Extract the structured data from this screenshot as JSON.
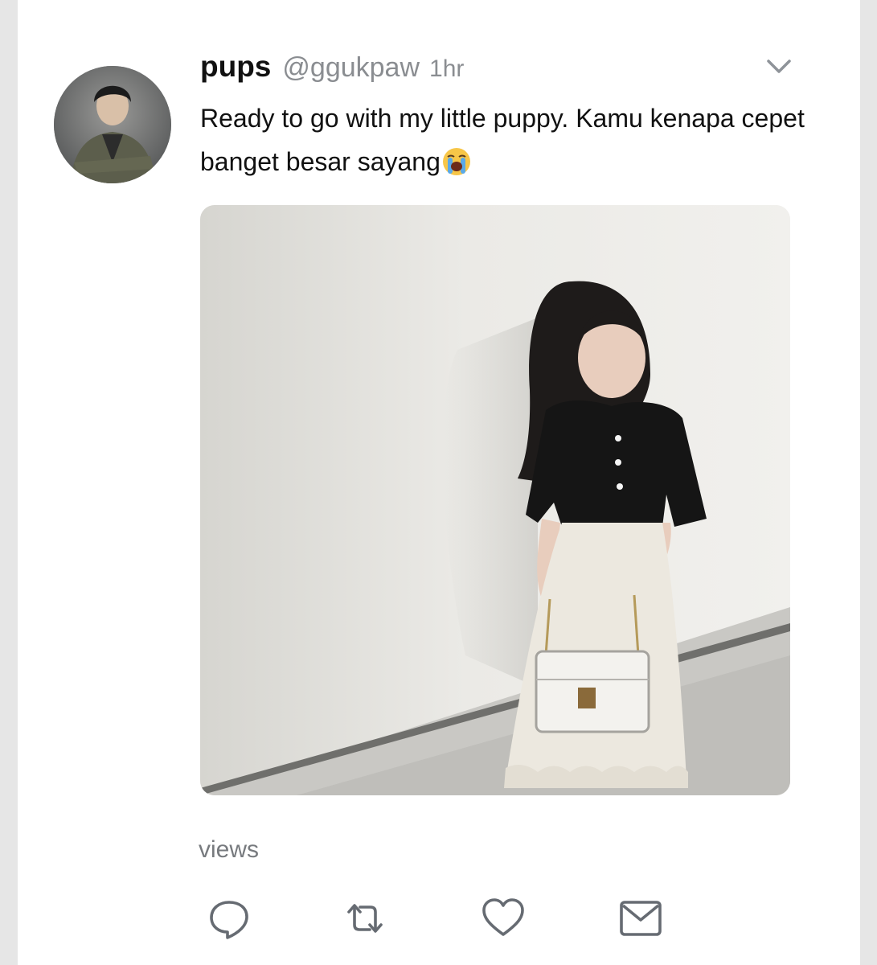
{
  "tweet": {
    "display_name": "pups",
    "handle": "@ggukpaw",
    "time": "1hr",
    "text": "Ready to go with my little puppy. Kamu kenapa cepet banget besar sayang",
    "emoji_icon": "loudly-crying-face-icon",
    "views_label": "views"
  },
  "actions": [
    {
      "icon": "reply-icon"
    },
    {
      "icon": "retweet-icon"
    },
    {
      "icon": "like-icon"
    },
    {
      "icon": "share-mail-icon"
    }
  ],
  "colors": {
    "background": "#e6e6e6",
    "card": "#ffffff",
    "text": "#111111",
    "muted": "#8a8d91",
    "icon_gray": "#666b72"
  }
}
